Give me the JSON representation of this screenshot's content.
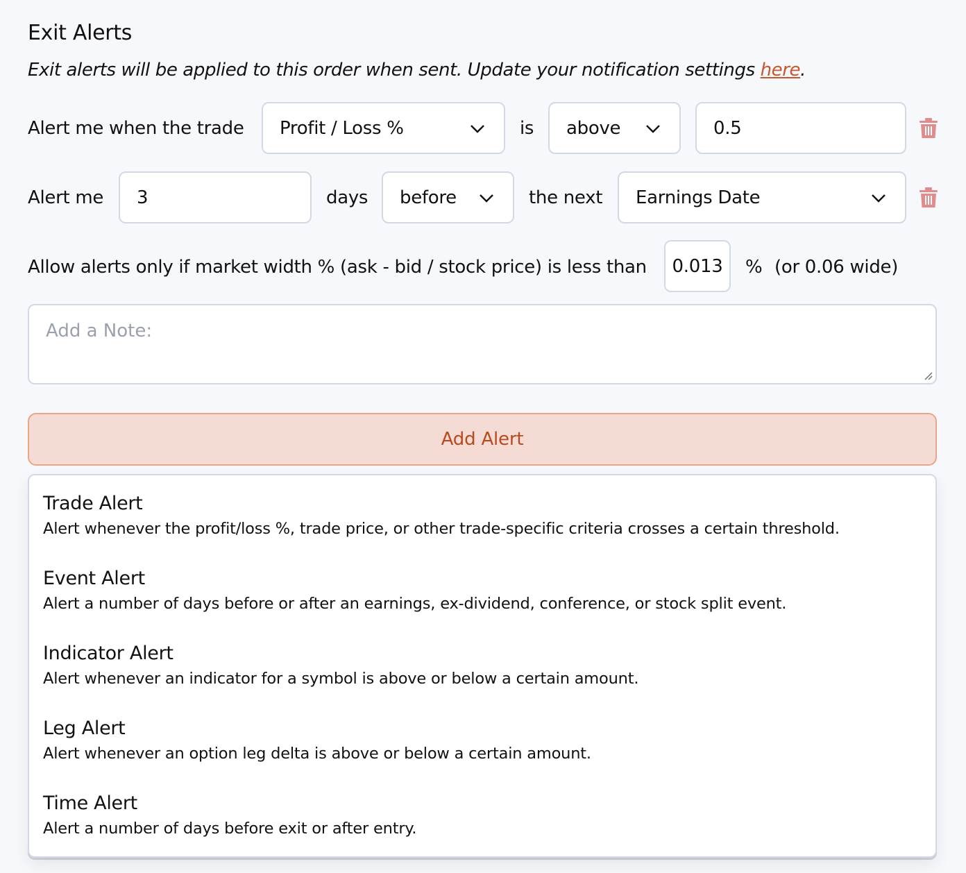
{
  "header": {
    "title": "Exit Alerts",
    "subtitle_text": "Exit alerts will be applied to this order when sent. Update your notification settings ",
    "subtitle_link": "here",
    "subtitle_end": "."
  },
  "alert_rows": [
    {
      "prefix": "Alert me when the trade",
      "field_select": "Profit / Loss %",
      "connector": "is",
      "comparison_select": "above",
      "value": "0.5",
      "delete_icon": "trash-icon"
    },
    {
      "prefix": "Alert me",
      "days_value": "3",
      "days_label": "days",
      "timing_select": "before",
      "connector": "the next",
      "event_select": "Earnings Date",
      "delete_icon": "trash-icon"
    }
  ],
  "market_width": {
    "label": "Allow alerts only if market width % (ask - bid / stock price) is less than",
    "value": "0.013",
    "unit": "%",
    "note": "(or 0.06 wide)"
  },
  "note": {
    "placeholder": "Add a Note:",
    "value": ""
  },
  "add_alert_button": "Add Alert",
  "alert_menu": [
    {
      "title": "Trade Alert",
      "description": "Alert whenever the profit/loss %, trade price, or other trade-specific criteria crosses a certain threshold."
    },
    {
      "title": "Event Alert",
      "description": "Alert a number of days before or after an earnings, ex-dividend, conference, or stock split event."
    },
    {
      "title": "Indicator Alert",
      "description": "Alert whenever an indicator for a symbol is above or below a certain amount."
    },
    {
      "title": "Leg Alert",
      "description": "Alert whenever an option leg delta is above or below a certain amount."
    },
    {
      "title": "Time Alert",
      "description": "Alert a number of days before exit or after entry."
    }
  ],
  "colors": {
    "accent": "#c8572b",
    "button_bg": "#f4dcd4",
    "button_border": "#e9a584",
    "delete": "#e08c8c"
  }
}
